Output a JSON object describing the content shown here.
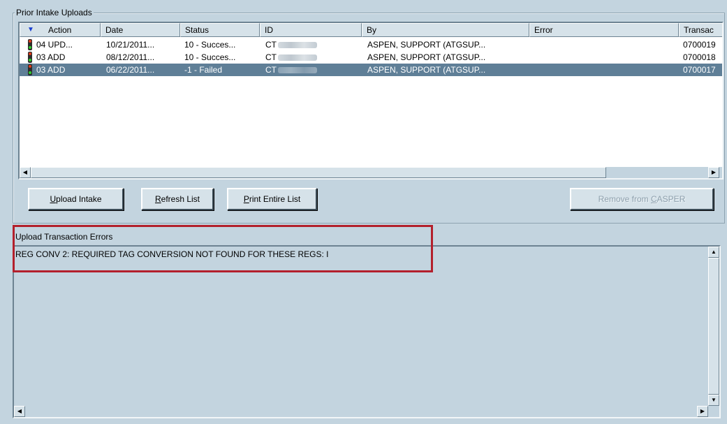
{
  "prior_uploads": {
    "label": "Prior Intake Uploads",
    "columns": [
      {
        "label": "Action"
      },
      {
        "label": "Date"
      },
      {
        "label": "Status"
      },
      {
        "label": "ID"
      },
      {
        "label": "By"
      },
      {
        "label": "Error"
      },
      {
        "label": "Transac"
      }
    ],
    "rows": [
      {
        "action": "04 UPD...",
        "date": "10/21/2011...",
        "status": "10 - Succes...",
        "id": "CT",
        "by": "ASPEN, SUPPORT (ATGSUP...",
        "error": "",
        "transaction": "0700019"
      },
      {
        "action": "03 ADD",
        "date": "08/12/2011...",
        "status": "10 - Succes...",
        "id": "CT",
        "by": "ASPEN, SUPPORT (ATGSUP...",
        "error": "",
        "transaction": "0700018"
      },
      {
        "action": "03 ADD",
        "date": "06/22/2011...",
        "status": "-1 - Failed",
        "id": "CT",
        "by": "ASPEN, SUPPORT (ATGSUP...",
        "error": "",
        "transaction": "0700017"
      }
    ],
    "selected_row": 2
  },
  "buttons": {
    "upload_intake": {
      "mnemonic": "U",
      "rest": "pload Intake"
    },
    "refresh_list": {
      "mnemonic": "R",
      "rest": "efresh List"
    },
    "print_entire_list": {
      "mnemonic": "P",
      "rest": "rint Entire List"
    },
    "remove_from_casper": {
      "pre": "Remove from ",
      "mnemonic": "C",
      "rest": "ASPER"
    }
  },
  "errors": {
    "label": "Upload Transaction Errors",
    "text": "REG CONV 2: REQUIRED TAG CONVERSION NOT FOUND FOR THESE REGS: I"
  },
  "colors": {
    "background": "#c3d4df",
    "selection": "#5f7f97",
    "highlight_box": "#b3202c"
  }
}
